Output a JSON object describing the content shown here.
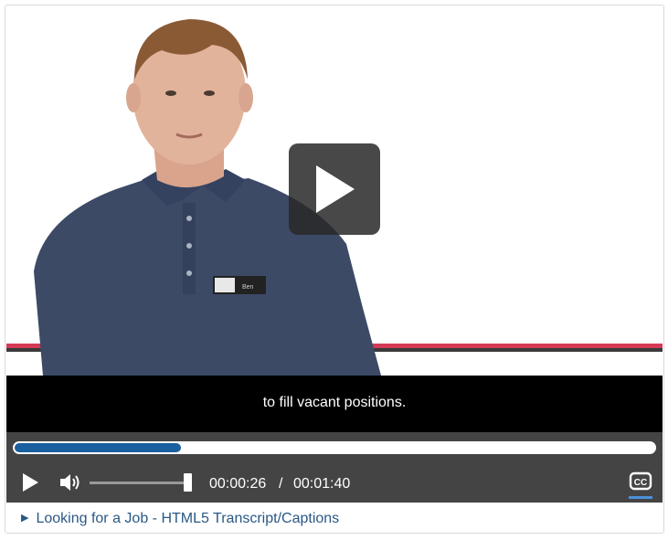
{
  "video": {
    "caption": "to fill vacant positions.",
    "badge_text": "Ben"
  },
  "progress": {
    "fraction": 0.26
  },
  "volume": {
    "level": 0.95
  },
  "time": {
    "current": "00:00:26",
    "separator": "/",
    "duration": "00:01:40"
  },
  "transcript": {
    "toggle_label": "Looking for a Job - HTML5 Transcript/Captions"
  },
  "icons": {
    "big_play": "play-icon",
    "play": "play-icon",
    "volume": "volume-icon",
    "captions": "closed-captions-icon",
    "expand": "triangle-right-icon"
  },
  "colors": {
    "controls_bg": "#444444",
    "progress_fill": "#1a5fa0",
    "cc_active": "#4a90d9",
    "link": "#2a5885"
  }
}
